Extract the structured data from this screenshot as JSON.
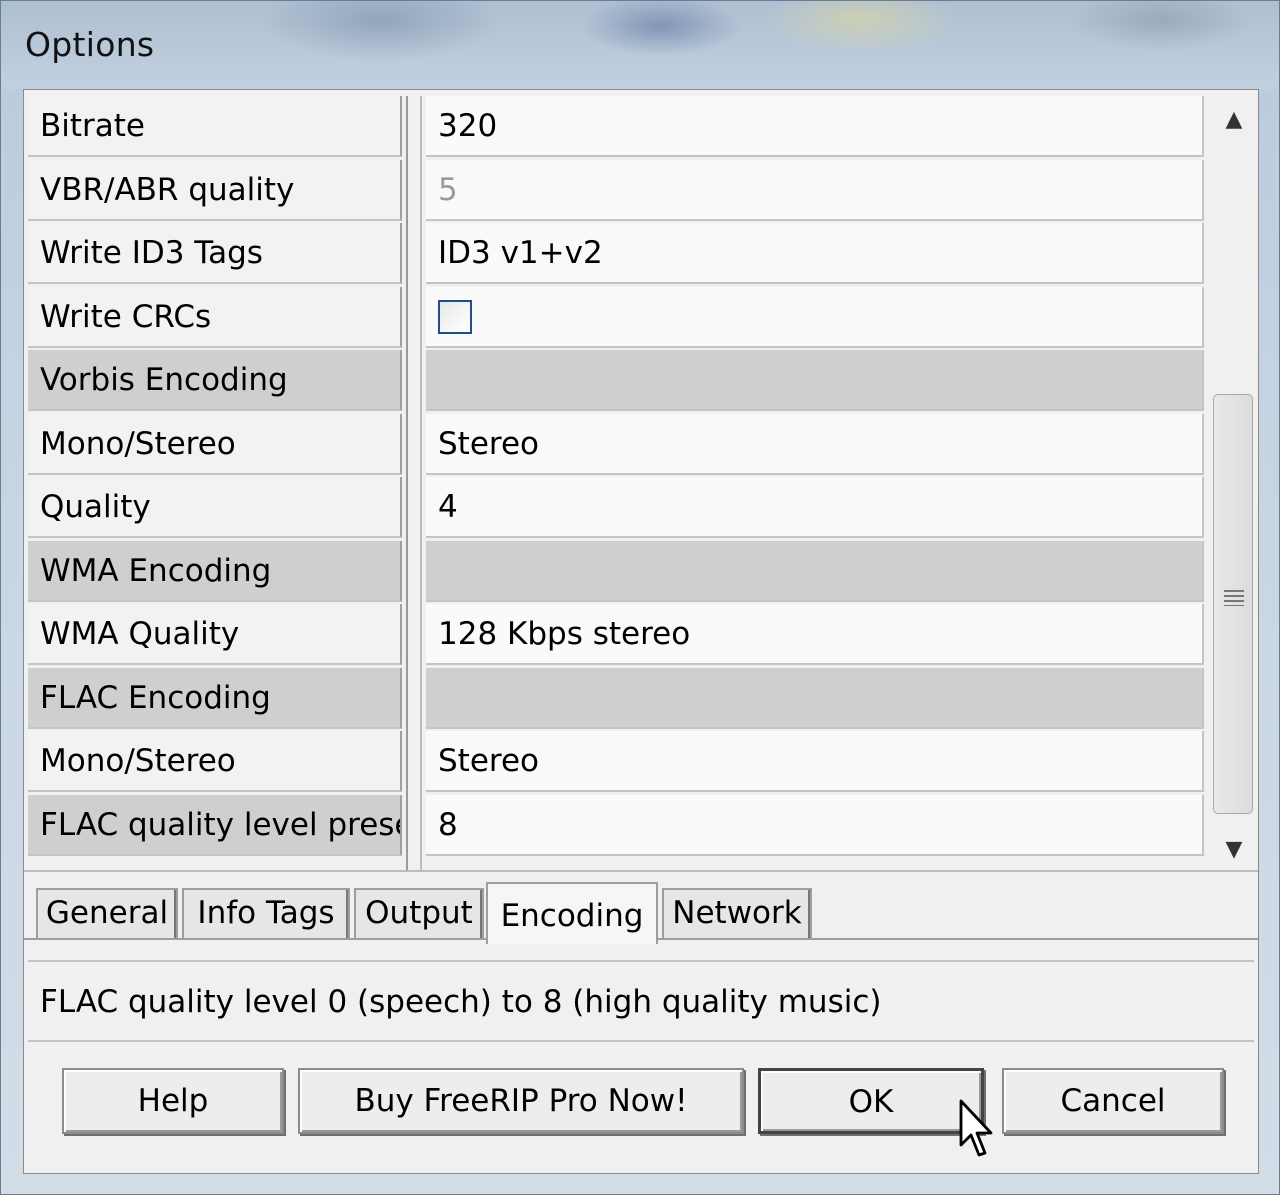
{
  "window": {
    "title": "Options"
  },
  "properties": [
    {
      "name": "Bitrate",
      "value": "320",
      "type": "text"
    },
    {
      "name": "VBR/ABR quality",
      "value": "5",
      "type": "disabled"
    },
    {
      "name": "Write ID3 Tags",
      "value": "ID3 v1+v2",
      "type": "text"
    },
    {
      "name": "Write CRCs",
      "value": "",
      "type": "checkbox",
      "checked": false
    },
    {
      "name": "Vorbis Encoding",
      "value": "",
      "type": "category"
    },
    {
      "name": "Mono/Stereo",
      "value": "Stereo",
      "type": "text"
    },
    {
      "name": "Quality",
      "value": "4",
      "type": "text"
    },
    {
      "name": "WMA Encoding",
      "value": "",
      "type": "category"
    },
    {
      "name": "WMA Quality",
      "value": "128 Kbps stereo",
      "type": "text"
    },
    {
      "name": "FLAC Encoding",
      "value": "",
      "type": "category"
    },
    {
      "name": "Mono/Stereo",
      "value": "Stereo",
      "type": "text"
    },
    {
      "name": "FLAC quality level preset",
      "value": "8",
      "type": "selected"
    }
  ],
  "tabs": [
    {
      "label": "General",
      "active": false
    },
    {
      "label": "Info Tags",
      "active": false
    },
    {
      "label": "Output",
      "active": false
    },
    {
      "label": "Encoding",
      "active": true
    },
    {
      "label": "Network",
      "active": false
    }
  ],
  "description": "FLAC quality level 0 (speech) to 8 (high quality music)",
  "buttons": {
    "help": "Help",
    "buy": "Buy FreeRIP Pro Now!",
    "ok": "OK",
    "cancel": "Cancel"
  },
  "scrollbar": {
    "up_icon": "up-arrow-icon",
    "down_icon": "down-arrow-icon",
    "grip_icon": "grip-icon"
  }
}
